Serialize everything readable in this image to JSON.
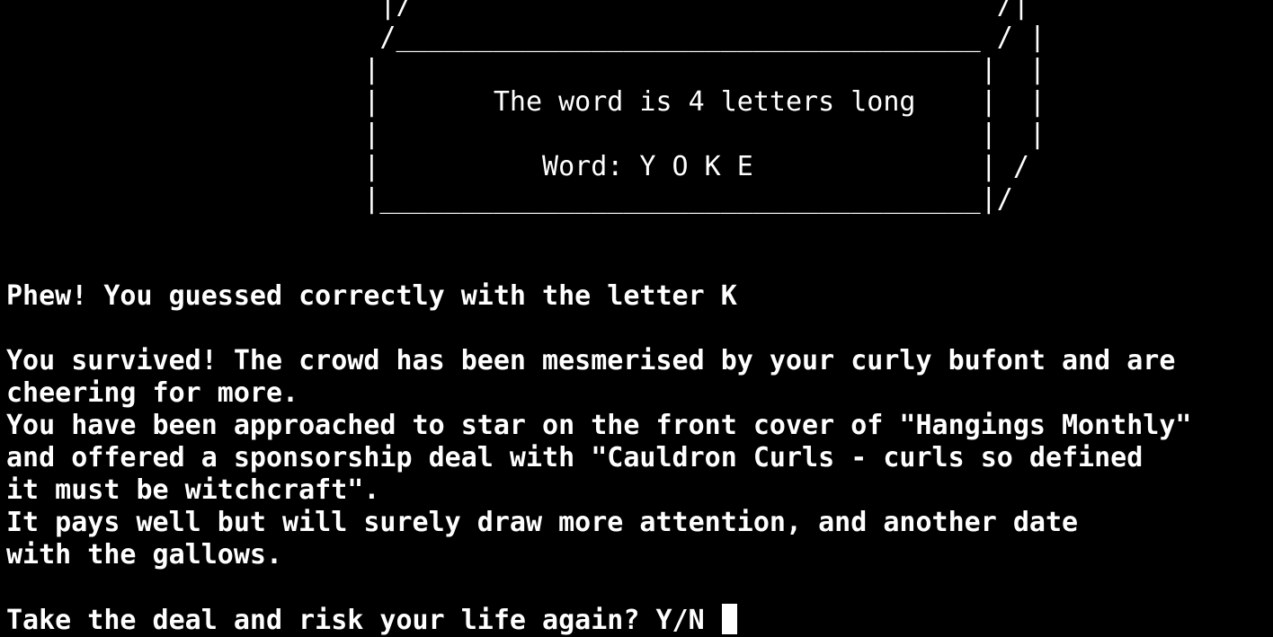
{
  "terminal": {
    "art_lines": [
      "                       |/                                    /|",
      "                       /____________________________________ / |",
      "                      |                                     |  |",
      "                      |       The word is 4 letters long    |  |",
      "                      |                                     |  |",
      "                      |          Word: Y O K E              | /",
      "                      |_____________________________________|/"
    ],
    "messages": {
      "guess_result": "Phew! You guessed correctly with the letter K",
      "story_1": "You survived! The crowd has been mesmerised by your curly bufont and are",
      "story_2": "cheering for more.",
      "story_3": "You have been approached to star on the front cover of \"Hangings Monthly\"",
      "story_4": "and offered a sponsorship deal with \"Cauldron Curls - curls so defined",
      "story_5": "it must be witchcraft\".",
      "story_6": "It pays well but will surely draw more attention, and another date",
      "story_7": "with the gallows.",
      "prompt": "Take the deal and risk your life again? Y/N "
    },
    "colors": {
      "background": "#000000",
      "text": "#ffffff"
    }
  }
}
